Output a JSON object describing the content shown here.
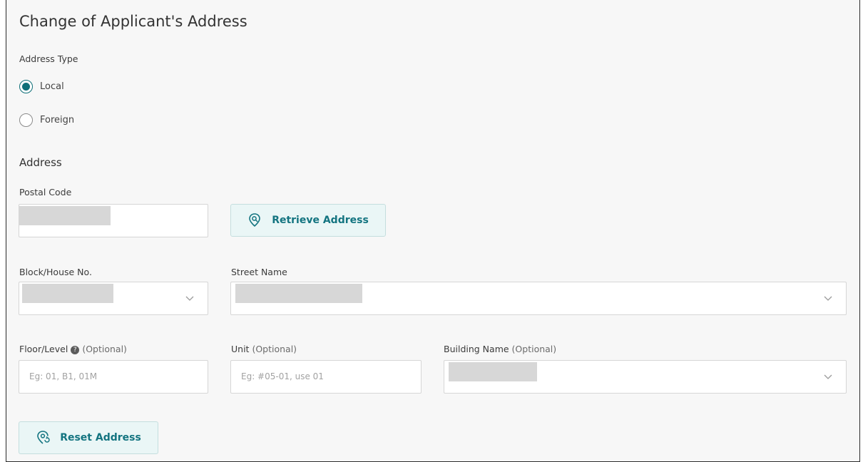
{
  "page": {
    "title": "Change of Applicant's Address"
  },
  "address_type": {
    "label": "Address Type",
    "options": [
      {
        "label": "Local",
        "checked": true
      },
      {
        "label": "Foreign",
        "checked": false
      }
    ]
  },
  "address": {
    "section_title": "Address",
    "postal_code": {
      "label": "Postal Code",
      "value": ""
    },
    "retrieve_button": {
      "label": "Retrieve Address",
      "icon": "location-search-icon"
    },
    "block": {
      "label": "Block/House No.",
      "value": ""
    },
    "street": {
      "label": "Street Name",
      "value": ""
    },
    "floor": {
      "label": "Floor/Level",
      "optional": "(Optional)",
      "placeholder": "Eg: 01, B1, 01M",
      "help_icon": "help-icon",
      "help_glyph": "?"
    },
    "unit": {
      "label": "Unit",
      "optional": "(Optional)",
      "placeholder": "Eg: #05-01, use 01"
    },
    "building": {
      "label": "Building Name",
      "optional": "(Optional)",
      "value": ""
    },
    "reset_button": {
      "label": "Reset Address",
      "icon": "location-reset-icon"
    }
  },
  "colors": {
    "accent": "#0f6f78",
    "button_bg": "#eaf6f6",
    "redacted": "#d7d7d7"
  }
}
